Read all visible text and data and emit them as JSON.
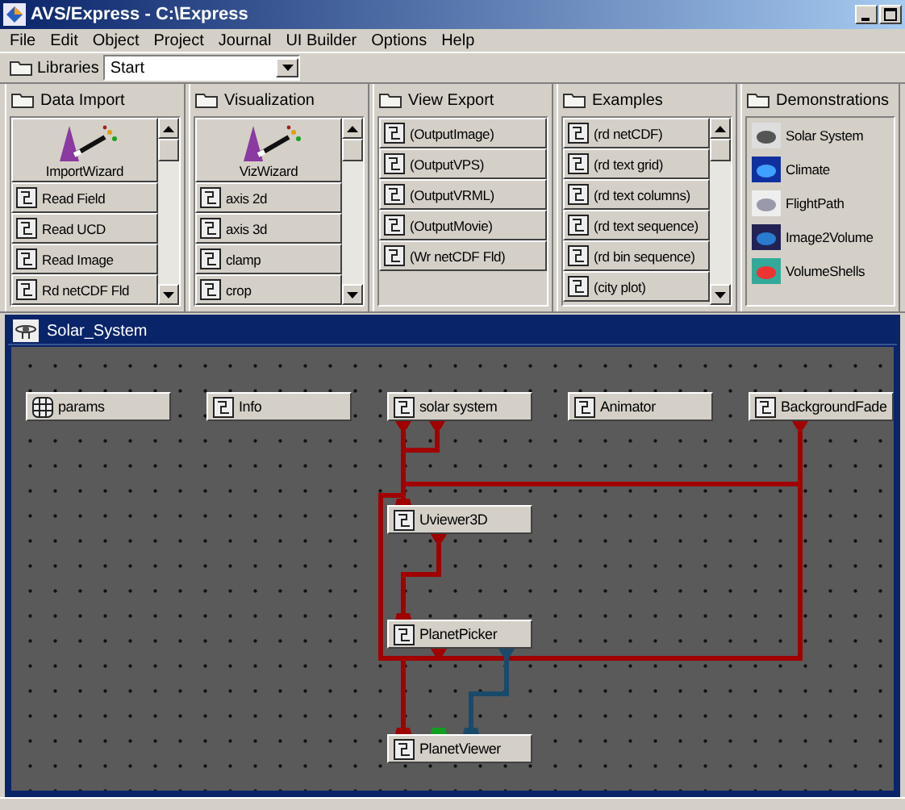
{
  "window": {
    "title": "AVS/Express - C:\\Express"
  },
  "menu": [
    "File",
    "Edit",
    "Object",
    "Project",
    "Journal",
    "UI Builder",
    "Options",
    "Help"
  ],
  "libraries": {
    "label": "Libraries",
    "value": "Start"
  },
  "panels": [
    {
      "title": "Data Import",
      "scrollable": true,
      "items": [
        {
          "kind": "wizard",
          "label": "ImportWizard"
        },
        {
          "kind": "module",
          "label": "Read Field"
        },
        {
          "kind": "module",
          "label": "Read UCD"
        },
        {
          "kind": "module",
          "label": "Read Image"
        },
        {
          "kind": "module",
          "label": "Rd netCDF Fld"
        }
      ]
    },
    {
      "title": "Visualization",
      "scrollable": true,
      "items": [
        {
          "kind": "wizard",
          "label": "VizWizard"
        },
        {
          "kind": "module",
          "label": "axis 2d"
        },
        {
          "kind": "module",
          "label": "axis 3d"
        },
        {
          "kind": "module",
          "label": "clamp"
        },
        {
          "kind": "module",
          "label": "crop"
        }
      ]
    },
    {
      "title": "View Export",
      "scrollable": false,
      "items": [
        {
          "kind": "module",
          "label": "(OutputImage)"
        },
        {
          "kind": "module",
          "label": "(OutputVPS)"
        },
        {
          "kind": "module",
          "label": "(OutputVRML)"
        },
        {
          "kind": "module",
          "label": "(OutputMovie)"
        },
        {
          "kind": "module",
          "label": "(Wr netCDF Fld)"
        }
      ]
    },
    {
      "title": "Examples",
      "scrollable": true,
      "items": [
        {
          "kind": "module",
          "label": "(rd netCDF)"
        },
        {
          "kind": "module",
          "label": "(rd text grid)"
        },
        {
          "kind": "module",
          "label": "(rd text columns)"
        },
        {
          "kind": "module",
          "label": "(rd text sequence)"
        },
        {
          "kind": "module",
          "label": "(rd bin sequence)"
        },
        {
          "kind": "module",
          "label": "(city plot)"
        }
      ]
    },
    {
      "title": "Demonstrations",
      "scrollable": false,
      "items": [
        {
          "kind": "demo",
          "label": "Solar System"
        },
        {
          "kind": "demo",
          "label": "Climate"
        },
        {
          "kind": "demo",
          "label": "FlightPath"
        },
        {
          "kind": "demo",
          "label": "Image2Volume"
        },
        {
          "kind": "demo",
          "label": "VolumeShells"
        }
      ]
    }
  ],
  "network": {
    "title": "Solar_System",
    "nodes": [
      {
        "kind": "group",
        "label": "params"
      },
      {
        "kind": "module",
        "label": "Info"
      },
      {
        "kind": "module",
        "label": "solar system"
      },
      {
        "kind": "module",
        "label": "Animator"
      },
      {
        "kind": "module",
        "label": "BackgroundFade"
      },
      {
        "kind": "module",
        "label": "Uviewer3D"
      },
      {
        "kind": "module",
        "label": "PlanetPicker"
      },
      {
        "kind": "module",
        "label": "PlanetViewer"
      }
    ]
  }
}
